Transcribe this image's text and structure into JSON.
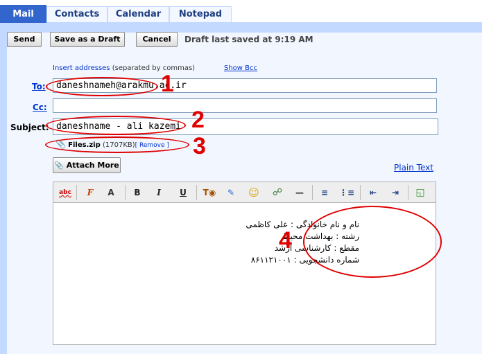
{
  "tabs": [
    {
      "label": "Mail"
    },
    {
      "label": "Contacts"
    },
    {
      "label": "Calendar"
    },
    {
      "label": "Notepad"
    }
  ],
  "toolbar": {
    "send_label": "Send",
    "draft_label": "Save as a Draft",
    "cancel_label": "Cancel",
    "status": "Draft last saved at 9:19 AM"
  },
  "compose": {
    "insert_addresses": "Insert addresses",
    "separated_hint": "(separated by commas)",
    "show_bcc": "Show Bcc",
    "to_label": "To:",
    "to_value": "daneshnameh@arakmu.ac.ir",
    "cc_label": "Cc:",
    "cc_value": "",
    "subject_label": "Subject:",
    "subject_value": "daneshname - ali kazemi",
    "attachment_name": "Files.zip",
    "attachment_size": "(1707KB)",
    "remove_label": "[ Remove ]",
    "attach_more_label": "Attach More",
    "plain_text_label": "Plain Text"
  },
  "editor_toolbar": {
    "spell": "abc",
    "font": "F",
    "size": "A",
    "bold": "B",
    "italic": "I",
    "underline": "U"
  },
  "annotations": [
    "1",
    "2",
    "3",
    "4"
  ],
  "body_lines": [
    "نام و نام خانوادگی : علی کاظمی",
    "رشته : بهداشت محیط",
    "مقطع : کارشناسی ارشد",
    "شماره دانشجویی : ۸۶۱۱۲۱۰۰۱"
  ],
  "colors": {
    "accent": "#3366cc",
    "panel": "#c3d9ff",
    "annotation": "#e00000"
  }
}
